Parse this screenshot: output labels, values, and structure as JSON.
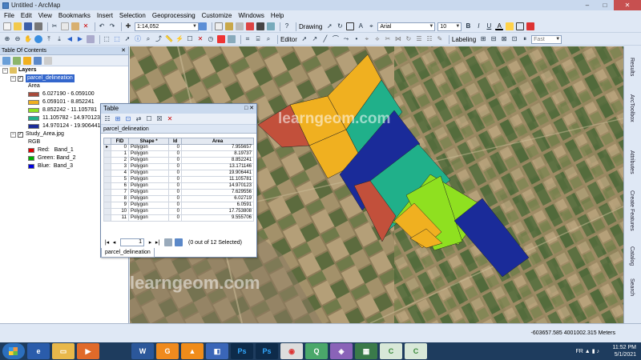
{
  "window": {
    "title": "Untitled - ArcMap"
  },
  "menu": [
    "File",
    "Edit",
    "View",
    "Bookmarks",
    "Insert",
    "Selection",
    "Geoprocessing",
    "Customize",
    "Windows",
    "Help"
  ],
  "toolbar": {
    "scale": "1:14,052",
    "drawing_label": "Drawing",
    "font_name": "Arial",
    "font_size": "10",
    "editor_label": "Editor",
    "labeling_label": "Labeling",
    "fast_label": "Fast"
  },
  "toc": {
    "title": "Table Of Contents",
    "layers_label": "Layers",
    "parcel_layer": "parcel_delineation",
    "area_field": "Area",
    "classes": [
      {
        "label": "6.027190 - 6.059100",
        "color": "#a84a3a"
      },
      {
        "label": "6.059101 - 8.852241",
        "color": "#f0b020"
      },
      {
        "label": "8.852242 - 11.105781",
        "color": "#8fe020"
      },
      {
        "label": "11.105782 - 14.970123",
        "color": "#20b08a"
      },
      {
        "label": "14.970124 - 19.906441",
        "color": "#1a2b99"
      }
    ],
    "raster_layer": "Study_Area.jpg",
    "rgb_label": "RGB",
    "bands": [
      {
        "label": "Red:   Band_1",
        "color": "#e00000"
      },
      {
        "label": "Green: Band_2",
        "color": "#00b000"
      },
      {
        "label": "Blue:  Band_3",
        "color": "#0000e0"
      }
    ]
  },
  "table": {
    "title": "Table",
    "tab_name": "parcel_delineation",
    "columns": [
      "FID",
      "Shape *",
      "Id",
      "Area"
    ],
    "rows": [
      [
        "0",
        "Polygon",
        "0",
        "7.955657"
      ],
      [
        "1",
        "Polygon",
        "0",
        "8.19737"
      ],
      [
        "2",
        "Polygon",
        "0",
        "8.852241"
      ],
      [
        "3",
        "Polygon",
        "0",
        "13.171146"
      ],
      [
        "4",
        "Polygon",
        "0",
        "19.906441"
      ],
      [
        "5",
        "Polygon",
        "0",
        "11.105781"
      ],
      [
        "6",
        "Polygon",
        "0",
        "14.970123"
      ],
      [
        "7",
        "Polygon",
        "0",
        "7.629556"
      ],
      [
        "8",
        "Polygon",
        "0",
        "6.02719"
      ],
      [
        "9",
        "Polygon",
        "0",
        "6.0591"
      ],
      [
        "10",
        "Polygon",
        "0",
        "17.753808"
      ],
      [
        "11",
        "Polygon",
        "0",
        "9.555706"
      ]
    ],
    "page": "1",
    "selection_status": "(0 out of 12 Selected)",
    "bottom_tab": "parcel_delineation"
  },
  "map": {
    "watermark": "learngeom.com"
  },
  "right_tabs": [
    "Results",
    "ArcToolbox",
    "Attributes",
    "Create Features",
    "Catalog",
    "Search"
  ],
  "status": {
    "coords": "-603657.585  4001002.315 Meters"
  },
  "taskbar": {
    "lang": "FR",
    "time": "11:52 PM",
    "date": "5/1/2021"
  }
}
